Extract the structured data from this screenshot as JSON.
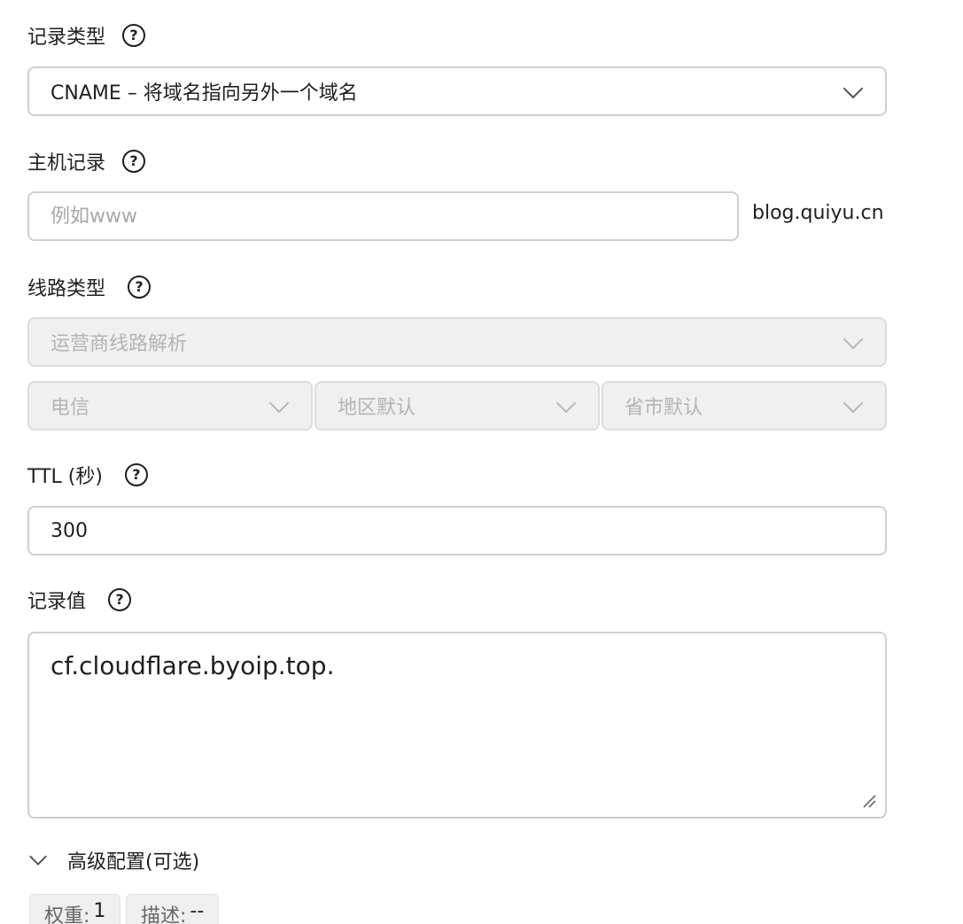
{
  "record_type": {
    "label": "记录类型",
    "help": "?",
    "value": "CNAME – 将域名指向另外一个域名"
  },
  "host_record": {
    "label": "主机记录",
    "help": "?",
    "placeholder": "例如www",
    "value": "",
    "suffix": "blog.quiyu.cn"
  },
  "line_type": {
    "label": "线路类型",
    "help": "?",
    "main_value": "运营商线路解析",
    "isp_value": "电信",
    "region_value": "地区默认",
    "province_value": "省市默认"
  },
  "ttl": {
    "label": "TTL (秒)",
    "help": "?",
    "value": "300"
  },
  "record_value": {
    "label": "记录值",
    "help": "?",
    "value": "cf.cloudflare.byoip.top."
  },
  "advanced": {
    "label": "高级配置(可选)",
    "weight_label": "权重:",
    "weight_value": "1",
    "desc_label": "描述:",
    "desc_value": "--"
  },
  "icons": {
    "help": "question-circle-icon",
    "dropdown": "chevron-down-icon"
  }
}
